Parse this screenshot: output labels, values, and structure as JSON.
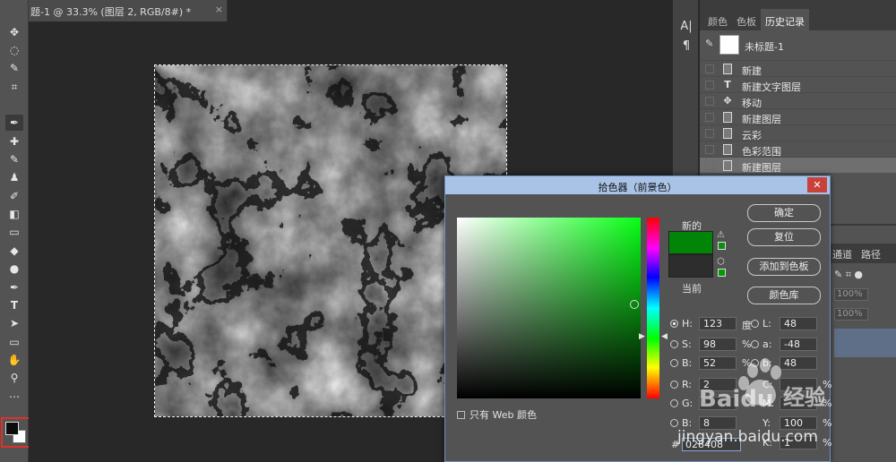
{
  "document_tab": {
    "title": "题-1 @ 33.3% (图层 2, RGB/8#) *",
    "close": "×"
  },
  "tools": [
    {
      "name": "move-icon",
      "glyph": "✥"
    },
    {
      "name": "marquee-icon",
      "glyph": "◌"
    },
    {
      "name": "quick-select-icon",
      "glyph": "✎"
    },
    {
      "name": "crop-icon",
      "glyph": "⌗"
    },
    {
      "name": "eyedropper-icon",
      "glyph": "✒"
    },
    {
      "name": "healing-icon",
      "glyph": "✚"
    },
    {
      "name": "brush-icon",
      "glyph": "✎"
    },
    {
      "name": "stamp-icon",
      "glyph": "♟"
    },
    {
      "name": "history-brush-icon",
      "glyph": "✐"
    },
    {
      "name": "eraser-icon",
      "glyph": "◧"
    },
    {
      "name": "gradient-icon",
      "glyph": "▭"
    },
    {
      "name": "blur-icon",
      "glyph": "💧"
    },
    {
      "name": "dodge-icon",
      "glyph": "●"
    },
    {
      "name": "pen-icon",
      "glyph": "✒"
    },
    {
      "name": "type-icon",
      "glyph": "T"
    },
    {
      "name": "path-select-icon",
      "glyph": "➤"
    },
    {
      "name": "rectangle-icon",
      "glyph": "▭"
    },
    {
      "name": "hand-icon",
      "glyph": "✋"
    },
    {
      "name": "zoom-icon",
      "glyph": "⚲"
    },
    {
      "name": "more-icon",
      "glyph": "⋯"
    }
  ],
  "mini_strip": {
    "char_icon": "A|",
    "para_icon": "¶"
  },
  "panel_tabs": [
    "颜色",
    "色板",
    "历史记录"
  ],
  "history": {
    "snapshot_label": "未标题-1",
    "items": [
      {
        "icon": "doc",
        "label": "新建"
      },
      {
        "icon": "T",
        "label": "新建文字图层"
      },
      {
        "icon": "✥",
        "label": "移动"
      },
      {
        "icon": "doc",
        "label": "新建图层"
      },
      {
        "icon": "doc",
        "label": "云彩"
      },
      {
        "icon": "doc",
        "label": "色彩范围"
      },
      {
        "icon": "doc",
        "label": "新建图层"
      }
    ]
  },
  "layers_fragment": {
    "tab_a": "通道",
    "tab_b": "路径",
    "opacity_a": "100%",
    "opacity_b": "100%"
  },
  "picker": {
    "title": "拾色器（前景色）",
    "close": "✕",
    "new_label": "新的",
    "current_label": "当前",
    "buttons": {
      "ok": "确定",
      "reset": "复位",
      "add_swatch": "添加到色板",
      "library": "颜色库"
    },
    "fields": {
      "H": {
        "label": "H:",
        "value": "123",
        "unit": "度"
      },
      "S": {
        "label": "S:",
        "value": "98",
        "unit": "%"
      },
      "B": {
        "label": "B:",
        "value": "52",
        "unit": "%"
      },
      "R": {
        "label": "R:",
        "value": "2",
        "unit": ""
      },
      "G": {
        "label": "G:",
        "value": "",
        "unit": ""
      },
      "Bc": {
        "label": "B:",
        "value": "8",
        "unit": ""
      },
      "L": {
        "label": "L:",
        "value": "48",
        "unit": ""
      },
      "a": {
        "label": "a:",
        "value": "-48",
        "unit": ""
      },
      "b": {
        "label": "b:",
        "value": "48",
        "unit": ""
      },
      "C": {
        "label": "C:",
        "value": "",
        "unit": "%"
      },
      "M": {
        "label": "M:",
        "value": "",
        "unit": "%"
      },
      "Y": {
        "label": "Y:",
        "value": "100",
        "unit": "%"
      },
      "K": {
        "label": "K:",
        "value": "1",
        "unit": "%"
      }
    },
    "web_only": "只有 Web 颜色",
    "hex_label": "#",
    "hex_value": "028408",
    "new_color": "#028408",
    "current_color": "#2d2d2d"
  },
  "watermark": {
    "brand": "Baidu",
    "suffix": "经验",
    "url": "jingyan.baidu.com"
  }
}
